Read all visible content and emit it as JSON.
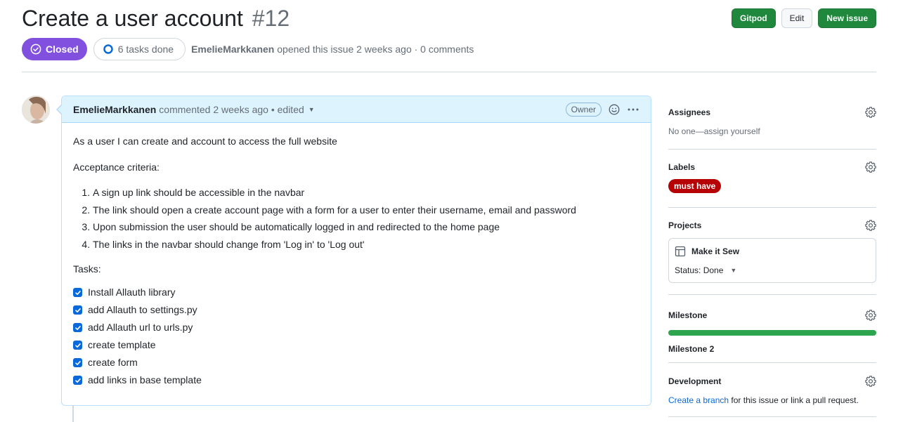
{
  "issue": {
    "title": "Create a user account",
    "number": "#12",
    "state": "Closed",
    "tasks_summary": "6 tasks done",
    "author": "EmelieMarkkanen",
    "opened_text": "opened this issue 2 weeks ago · 0 comments"
  },
  "header_buttons": {
    "gitpod": "Gitpod",
    "edit": "Edit",
    "new_issue": "New issue"
  },
  "comment": {
    "author": "EmelieMarkkanen",
    "meta": "commented 2 weeks ago • edited",
    "role_badge": "Owner",
    "intro": "As a user I can create and account to access the full website",
    "criteria_heading": "Acceptance criteria:",
    "criteria": [
      "A sign up link should be accessible in the navbar",
      "The link should open a create account page with a form for a user to enter their username, email and password",
      "Upon submission the user should be automatically logged in and redirected to the home page",
      "The links in the navbar should change from 'Log in' to 'Log out'"
    ],
    "tasks_heading": "Tasks:",
    "tasks": [
      "Install Allauth library",
      "add Allauth to settings.py",
      "add Allauth url to urls.py",
      "create template",
      "create form",
      "add links in base template"
    ]
  },
  "sidebar": {
    "assignees": {
      "heading": "Assignees",
      "value": "No one—assign yourself"
    },
    "labels": {
      "heading": "Labels",
      "items": [
        {
          "name": "must have",
          "color": "#b60205"
        }
      ]
    },
    "projects": {
      "heading": "Projects",
      "project_name": "Make it Sew",
      "status": "Status: Done"
    },
    "milestone": {
      "heading": "Milestone",
      "name": "Milestone 2",
      "progress_percent": 100
    },
    "development": {
      "heading": "Development",
      "link_text": "Create a branch",
      "rest_text": " for this issue or link a pull request."
    }
  },
  "colors": {
    "closed_badge": "#8250df",
    "primary_green": "#1f883d",
    "progress_green": "#2da44e",
    "link_blue": "#0969da",
    "comment_header_bg": "#ddf4ff"
  }
}
